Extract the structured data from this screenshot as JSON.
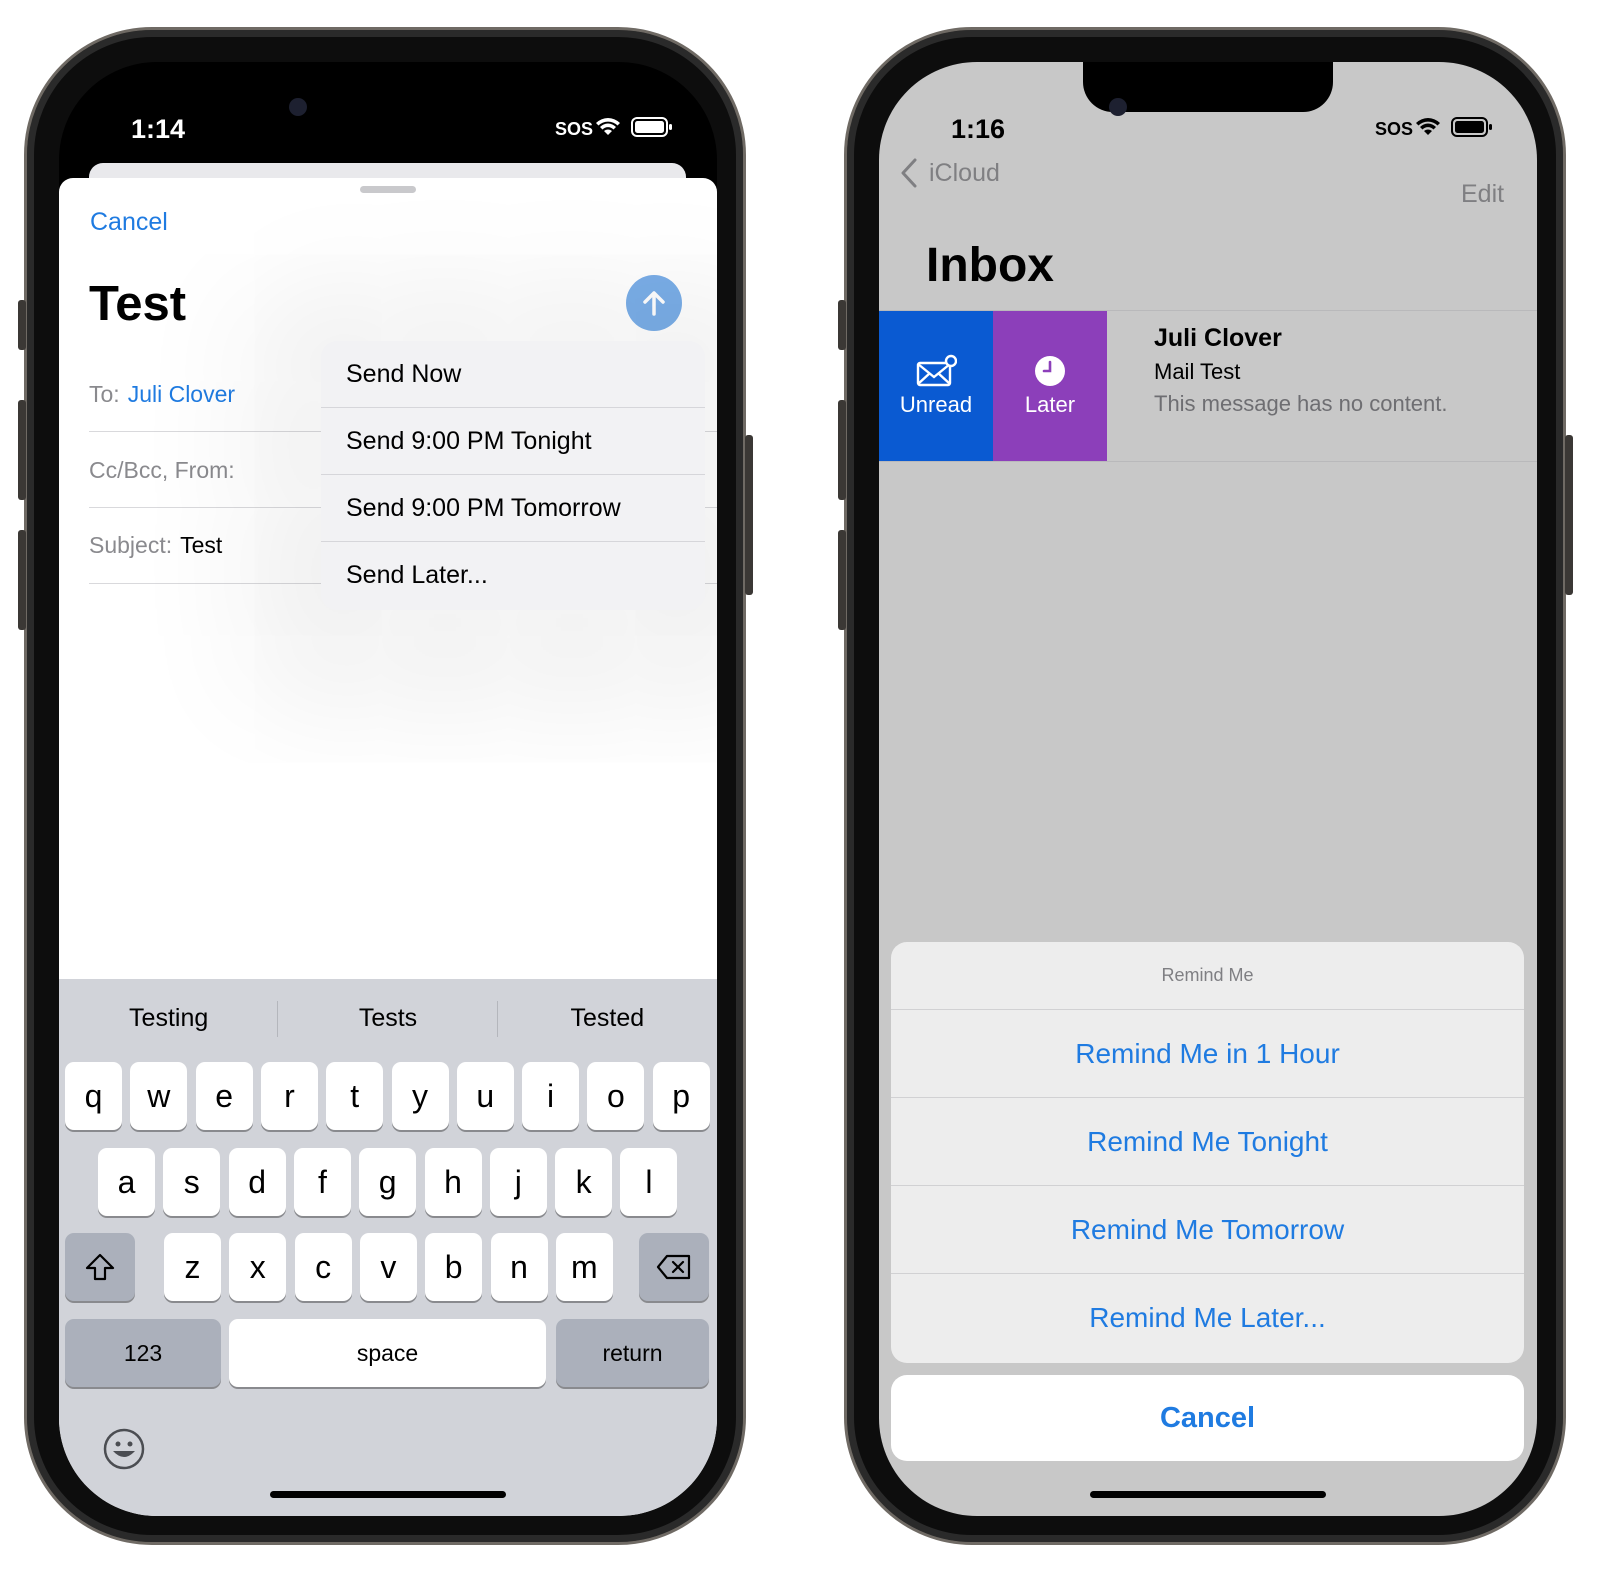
{
  "left_phone": {
    "status": {
      "time": "1:14",
      "sos": "SOS"
    },
    "compose": {
      "cancel": "Cancel",
      "title": "Test",
      "to_label": "To:",
      "to_value": "Juli Clover",
      "ccbcc_label": "Cc/Bcc, From:",
      "subject_label": "Subject:",
      "subject_value": "Test"
    },
    "send_menu": {
      "items": [
        "Send Now",
        "Send 9:00 PM Tonight",
        "Send 9:00 PM Tomorrow",
        "Send Later..."
      ]
    },
    "keyboard": {
      "suggestions": [
        "Testing",
        "Tests",
        "Tested"
      ],
      "row1": [
        "q",
        "w",
        "e",
        "r",
        "t",
        "y",
        "u",
        "i",
        "o",
        "p"
      ],
      "row2": [
        "a",
        "s",
        "d",
        "f",
        "g",
        "h",
        "j",
        "k",
        "l"
      ],
      "row3": [
        "z",
        "x",
        "c",
        "v",
        "b",
        "n",
        "m"
      ],
      "numbers_key": "123",
      "space_key": "space",
      "return_key": "return"
    }
  },
  "right_phone": {
    "status": {
      "time": "1:16",
      "sos": "SOS"
    },
    "nav": {
      "back": "iCloud",
      "edit": "Edit",
      "title": "Inbox"
    },
    "swipe_actions": {
      "unread": "Unread",
      "later": "Later"
    },
    "message": {
      "from": "Juli Clover",
      "subject": "Mail Test",
      "preview": "This message has no content."
    },
    "remind_sheet": {
      "title": "Remind Me",
      "options": [
        "Remind Me in 1 Hour",
        "Remind Me Tonight",
        "Remind Me Tomorrow",
        "Remind Me Later..."
      ],
      "cancel": "Cancel"
    }
  },
  "colors": {
    "ios_blue": "#1f7be1",
    "unread_blue": "#0a5ad2",
    "later_purple": "#8c3fba"
  }
}
